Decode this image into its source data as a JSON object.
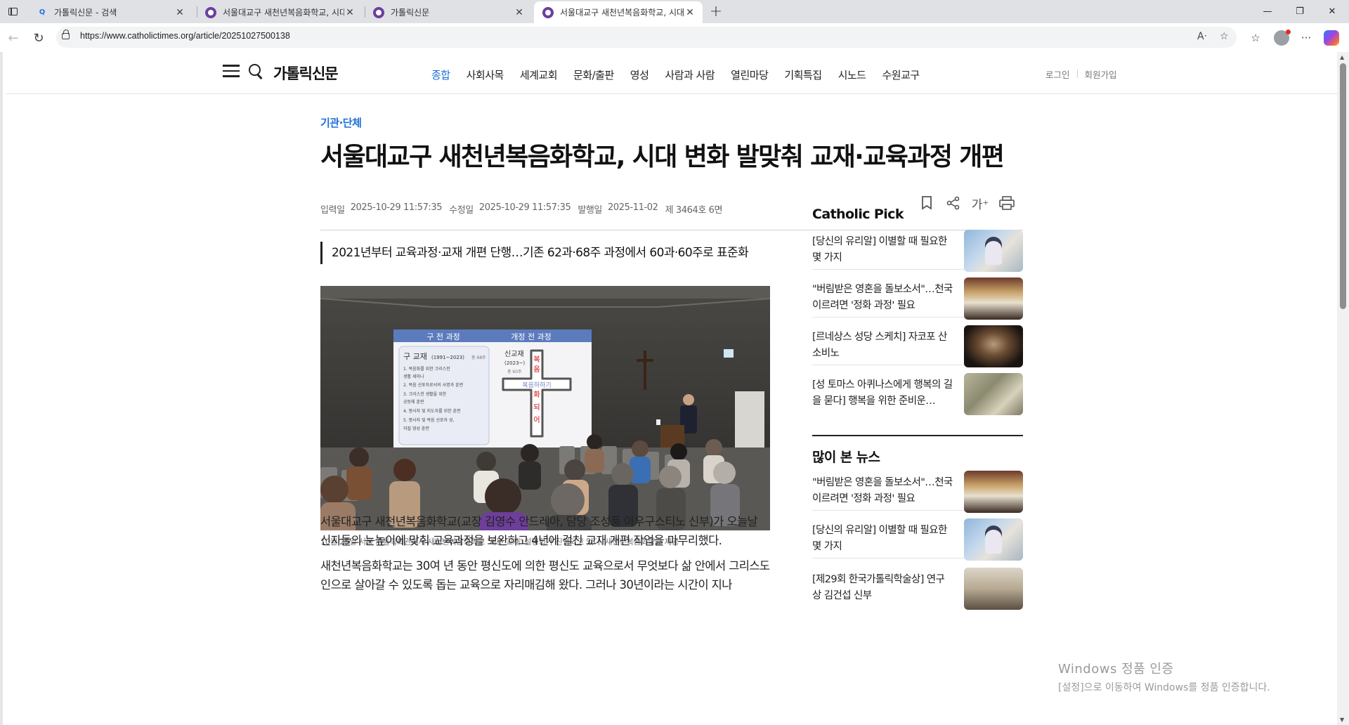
{
  "browser": {
    "tabs": [
      {
        "title": "가톨릭신문 - 검색",
        "icon": "search-icon",
        "active": false
      },
      {
        "title": "서울대교구 새천년복음화학교, 시대",
        "icon": "catholictimes-favicon",
        "active": false
      },
      {
        "title": "가톨릭신문",
        "icon": "catholictimes-favicon",
        "active": false
      },
      {
        "title": "서울대교구 새천년복음화학교, 시대",
        "icon": "catholictimes-favicon",
        "active": true
      }
    ],
    "url": "https://www.catholictimes.org/article/20251027500138"
  },
  "header": {
    "logo": "가톨릭신문",
    "nav": [
      "종합",
      "사회사목",
      "세계교회",
      "문화/출판",
      "영성",
      "사람과 사람",
      "열린마당",
      "기획특집",
      "시노드",
      "수원교구"
    ],
    "active_nav": "종합",
    "login": "로그인",
    "signup": "회원가입"
  },
  "article": {
    "category": "기관·단체",
    "title": "서울대교구 새천년복음화학교, 시대 변화 발맞춰 교재·교육과정 개편",
    "meta": {
      "input_label": "입력일",
      "input_value": "2025-10-29 11:57:35",
      "modified_label": "수정일",
      "modified_value": "2025-10-29 11:57:35",
      "published_label": "발행일",
      "published_value": "2025-11-02",
      "issue": "제 3464호 6면"
    },
    "font_size_button": "가⁺",
    "subhead": "2021년부터 교육과정·교재 개편 단행…기존 62과·68주 과정에서 60과·60주로 표준화",
    "photo": {
      "slide_header_left": "구 전 과정",
      "slide_header_right": "개정 전 과정",
      "slide_old_title": "구 교재",
      "slide_old_years": "(1991~2023)",
      "slide_old_total": "총 68주",
      "slide_old_lines": [
        "1. 복음화를 위한 크리스천",
        "   생활 세미나",
        "2. 복음 선포자로서의 사명과 훈련",
        "3. 크리스천 생활을 위한",
        "   공동체 훈련",
        "4. 봉사자 및 지도자를 위한 훈련",
        "5. 봉사자 및 복음 선포자 성,",
        "   자질 영성 훈련"
      ],
      "slide_new_title": "신교재",
      "slide_new_years": "(2023~)",
      "slide_new_total": "총 60주",
      "slide_cross_vertical": [
        "복",
        "음",
        "화",
        "되",
        "어"
      ],
      "slide_cross_horizontal": "복음하하기"
    },
    "caption": "10월 25일 서울 가톨릭회관에서 새천년복음화학교 '개편 교재' 설명회가 진행되고 있다. 새천년복음화학교 제공",
    "paragraphs": [
      "서울대교구 새천년복음화학교(교장 김영수 안드레아, 담당 조성풍 아우구스티노 신부)가 오늘날 신자들의 눈높이에 맞춰 교육과정을 보완하고 4년에 걸친 교재 개편 작업을 마무리했다.",
      "새천년복음화학교는 30여 년 동안 평신도에 의한 평신도 교육으로서 무엇보다 삶 안에서 그리스도인으로 살아갈 수 있도록 돕는 교육으로 자리매김해 왔다. 그러나 30년이라는 시간이 지나"
    ]
  },
  "sidebar": {
    "pick_title": "Catholic Pick",
    "pick_items": [
      {
        "text": "[당신의 유리알] 이별할 때 필요한 몇 가지",
        "thumb": "nun-photo"
      },
      {
        "text": "\"버림받은 영혼을 돌보소서\"…천국 이르려면 '정화 과정' 필요",
        "thumb": "church-mass-photo"
      },
      {
        "text": "[르네상스 성당 스케치] 자코포 산소비노",
        "thumb": "portrait-painting"
      },
      {
        "text": "[성 토마스 아퀴나스에게 행복의 길을 묻다] 행복을 위한 준비운…",
        "thumb": "classical-painting"
      }
    ],
    "popular_title": "많이 본 뉴스",
    "popular_items": [
      {
        "text": "\"버림받은 영혼을 돌보소서\"…천국 이르려면 '정화 과정' 필요",
        "thumb": "church-mass-photo"
      },
      {
        "text": "[당신의 유리알] 이별할 때 필요한 몇 가지",
        "thumb": "nun-photo"
      },
      {
        "text": "[제29회 한국가톨릭학술상] 연구상 김건섭 신부",
        "thumb": "man-portrait-photo"
      }
    ]
  },
  "windows_activation": {
    "line1": "Windows 정품 인증",
    "line2": "[설정]으로 이동하여 Windows를 정품 인증합니다."
  }
}
